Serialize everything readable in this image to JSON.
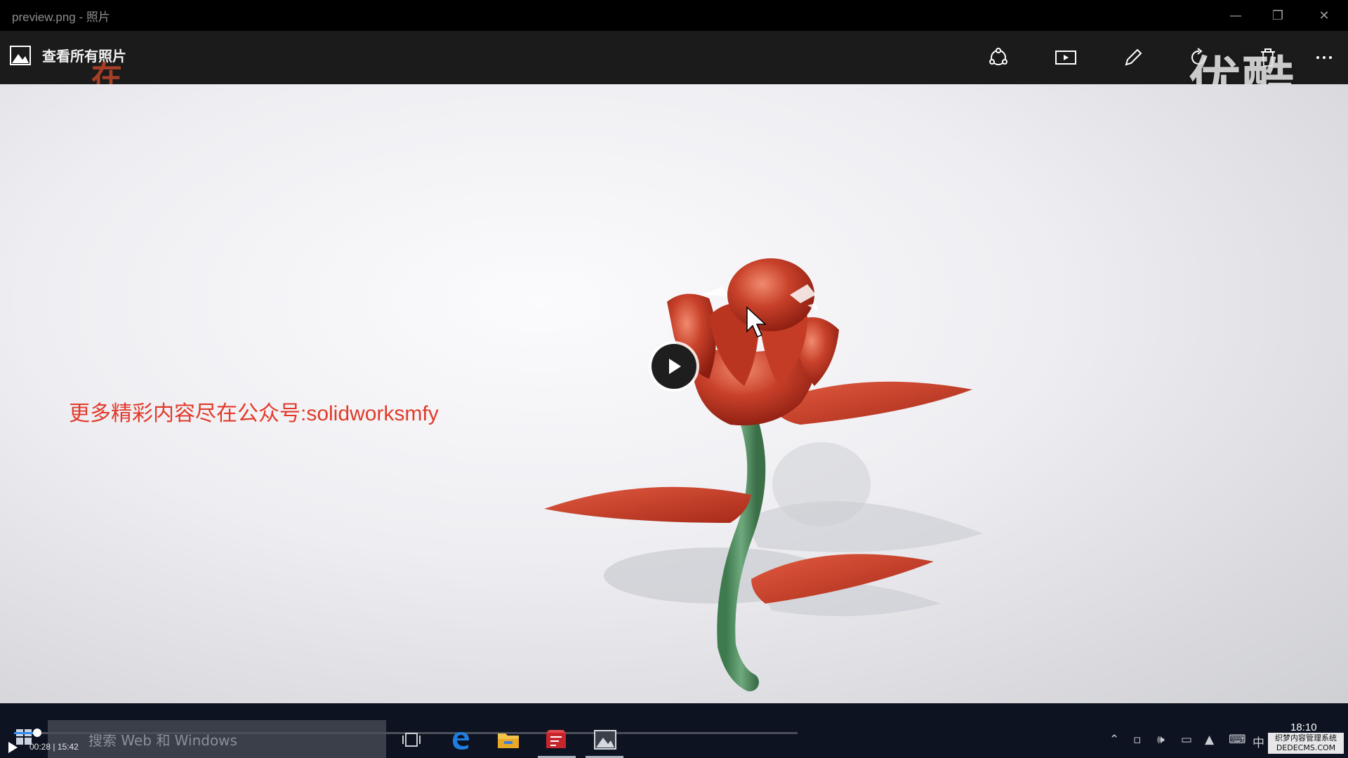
{
  "window": {
    "title": "preview.png - 照片"
  },
  "toolbar": {
    "view_all_label": "查看所有照片",
    "overlay_char": "在",
    "watermark_logo": "优酷"
  },
  "viewer": {
    "promo_cn": "更多精彩内容尽在公众号",
    "promo_en": ":solidworksmfy"
  },
  "player": {
    "time": "00:28 | 15:42",
    "progress": 0.03
  },
  "taskbar": {
    "search_placeholder": "搜索 Web 和 Windows",
    "clock": "18:10",
    "tray_ime": "中",
    "corner_watermark_line1": "织梦内容管理系统",
    "corner_watermark_line2": "DEDECMS.COM"
  },
  "colors": {
    "accent": "#2f8ef0",
    "promo_red": "#e23a2a",
    "stem_green": "#4e8a5c"
  }
}
